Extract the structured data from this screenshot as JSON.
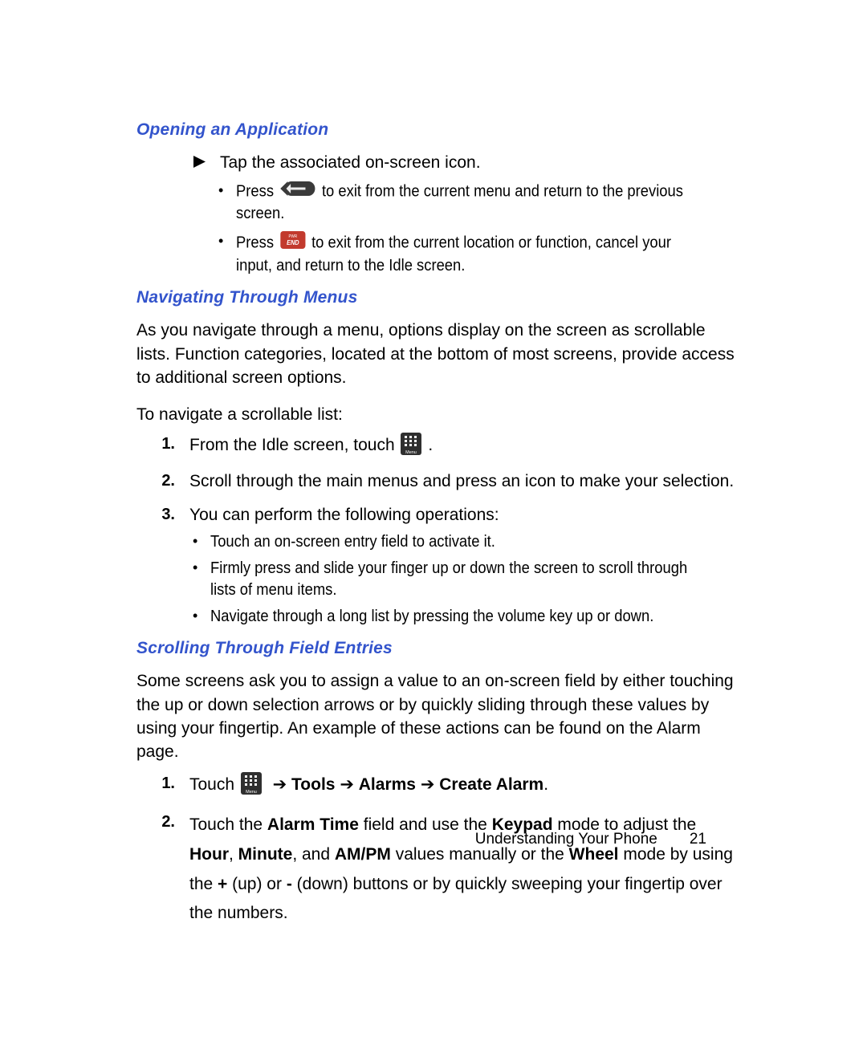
{
  "sections": {
    "s1": {
      "heading": "Opening an Application",
      "tap_line": "Tap the associated on-screen icon.",
      "press1_a": "Press",
      "press1_b": "to exit from the current menu and return to the previous screen.",
      "press2_a": "Press",
      "press2_b": "to exit from the current location or function, cancel your input, and return to the Idle screen."
    },
    "s2": {
      "heading": "Navigating Through Menus",
      "intro": "As you navigate through a menu, options display on the screen as scrollable lists. Function categories, located at the bottom of most screens, provide access to additional screen options.",
      "nav_prompt": "To navigate a scrollable list:",
      "step1_a": "From the Idle screen, touch",
      "step1_b": ".",
      "step2": "Scroll through the main menus and press an icon to make your selection.",
      "step3": "You can perform the following operations:",
      "sub1": "Touch an on-screen entry field to activate it.",
      "sub2": "Firmly press and slide your finger up or down the screen to scroll through lists of menu items.",
      "sub3": "Navigate through a long list by pressing the volume key up or down."
    },
    "s3": {
      "heading": "Scrolling Through Field Entries",
      "intro": "Some screens ask you to assign a value to an on-screen field by either touching the up or down selection arrows or by quickly sliding through these values by using your fingertip. An example of these actions can be found on the Alarm page.",
      "step1_a": "Touch",
      "step1_b1": "Tools",
      "step1_b2": "Alarms",
      "step1_b3": "Create Alarm",
      "step2_t1": "Touch the ",
      "step2_b1": "Alarm Time",
      "step2_t2": " field and use the ",
      "step2_b2": "Keypad",
      "step2_t3": " mode to adjust the ",
      "step2_b3": "Hour",
      "step2_t4": ", ",
      "step2_b4": "Minute",
      "step2_t5": ", and ",
      "step2_b5": "AM/PM",
      "step2_t6": " values manually or the ",
      "step2_b6": "Wheel",
      "step2_t7": " mode by using the ",
      "step2_b7": "+",
      "step2_t8": " (up) or ",
      "step2_b8": "-",
      "step2_t9": " (down) buttons or by quickly sweeping your fingertip over the numbers."
    }
  },
  "markers": {
    "n1": "1.",
    "n2": "2.",
    "n3": "3.",
    "bullet": "•",
    "arrow_glyph": "➔"
  },
  "footer": {
    "section": "Understanding Your Phone",
    "page": "21"
  },
  "icons": {
    "back_key": "back-key-icon",
    "end_key": "end-key-icon",
    "menu_key": "menu-key-icon"
  }
}
